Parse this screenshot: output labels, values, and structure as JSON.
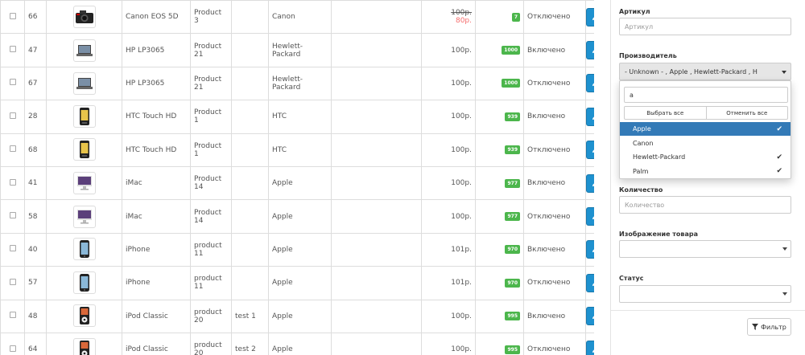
{
  "products": [
    {
      "id": "66",
      "name": "Canon EOS 5D",
      "model": "Product 3",
      "sku": "",
      "manufacturer": "Canon",
      "price_old": "100р.",
      "price_new": "80р.",
      "quantity": "7",
      "status": "Отключено",
      "image": "camera"
    },
    {
      "id": "47",
      "name": "HP LP3065",
      "model": "Product 21",
      "sku": "",
      "manufacturer": "Hewlett-Packard",
      "price": "100р.",
      "quantity": "1000",
      "status": "Включено",
      "image": "laptop"
    },
    {
      "id": "67",
      "name": "HP LP3065",
      "model": "Product 21",
      "sku": "",
      "manufacturer": "Hewlett-Packard",
      "price": "100р.",
      "quantity": "1000",
      "status": "Отключено",
      "image": "laptop"
    },
    {
      "id": "28",
      "name": "HTC Touch HD",
      "model": "Product 1",
      "sku": "",
      "manufacturer": "HTC",
      "price": "100р.",
      "quantity": "939",
      "status": "Включено",
      "image": "phone"
    },
    {
      "id": "68",
      "name": "HTC Touch HD",
      "model": "Product 1",
      "sku": "",
      "manufacturer": "HTC",
      "price": "100р.",
      "quantity": "939",
      "status": "Отключено",
      "image": "phone"
    },
    {
      "id": "41",
      "name": "iMac",
      "model": "Product 14",
      "sku": "",
      "manufacturer": "Apple",
      "price": "100р.",
      "quantity": "977",
      "status": "Включено",
      "image": "imac"
    },
    {
      "id": "58",
      "name": "iMac",
      "model": "Product 14",
      "sku": "",
      "manufacturer": "Apple",
      "price": "100р.",
      "quantity": "977",
      "status": "Отключено",
      "image": "imac"
    },
    {
      "id": "40",
      "name": "iPhone",
      "model": "product 11",
      "sku": "",
      "manufacturer": "Apple",
      "price": "101р.",
      "quantity": "970",
      "status": "Включено",
      "image": "iphone"
    },
    {
      "id": "57",
      "name": "iPhone",
      "model": "product 11",
      "sku": "",
      "manufacturer": "Apple",
      "price": "101р.",
      "quantity": "970",
      "status": "Отключено",
      "image": "iphone"
    },
    {
      "id": "48",
      "name": "iPod Classic",
      "model": "product 20",
      "sku": "test 1",
      "manufacturer": "Apple",
      "price": "100р.",
      "quantity": "995",
      "status": "Включено",
      "image": "ipod"
    },
    {
      "id": "64",
      "name": "iPod Classic",
      "model": "product 20",
      "sku": "test 2",
      "manufacturer": "Apple",
      "price": "100р.",
      "quantity": "995",
      "status": "Отключено",
      "image": "ipod"
    }
  ],
  "filter": {
    "sku_label": "Артикул",
    "sku_placeholder": "Артикул",
    "manufacturer_label": "Производитель",
    "manufacturer_selected": "- Unknown - ,  Apple  ,  Hewlett-Packard  ,  H",
    "dropdown": {
      "search_value": "a",
      "select_all": "Выбрать все",
      "deselect_all": "Отменить все",
      "options": [
        {
          "label": "Apple",
          "checked": true,
          "highlighted": true
        },
        {
          "label": "Canon",
          "checked": false,
          "highlighted": false
        },
        {
          "label": "Hewlett-Packard",
          "checked": true,
          "highlighted": false
        },
        {
          "label": "Palm",
          "checked": true,
          "highlighted": false
        }
      ]
    },
    "quantity_label": "Количество",
    "quantity_placeholder": "Количество",
    "image_label": "Изображение товара",
    "status_label": "Статус",
    "filter_button": "Фильтр"
  },
  "colors": {
    "accent": "#1e91cf",
    "badge": "#4cb64c",
    "special_price": "#f56b6b",
    "highlight": "#337ab7"
  }
}
